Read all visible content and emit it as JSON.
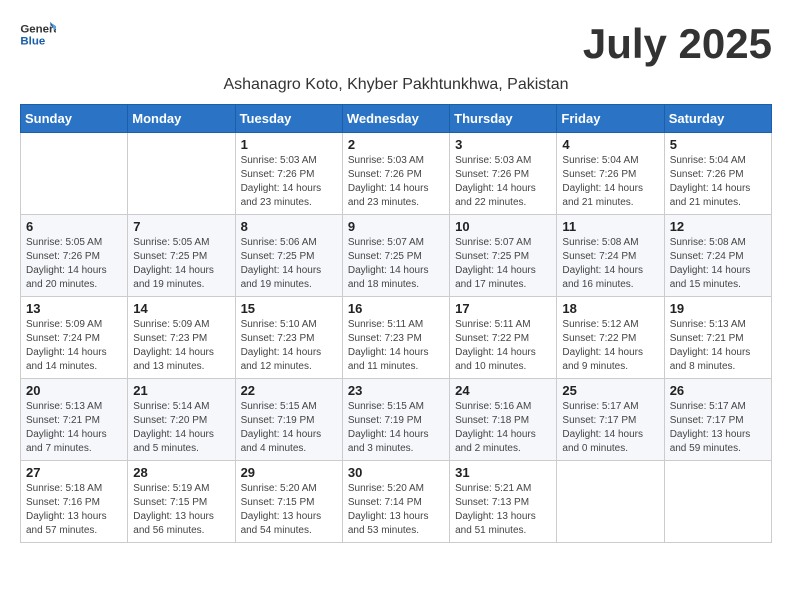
{
  "header": {
    "logo_line1": "General",
    "logo_line2": "Blue",
    "month": "July 2025",
    "location": "Ashanagro Koto, Khyber Pakhtunkhwa, Pakistan"
  },
  "weekdays": [
    "Sunday",
    "Monday",
    "Tuesday",
    "Wednesday",
    "Thursday",
    "Friday",
    "Saturday"
  ],
  "weeks": [
    [
      {
        "day": "",
        "sunrise": "",
        "sunset": "",
        "daylight": ""
      },
      {
        "day": "",
        "sunrise": "",
        "sunset": "",
        "daylight": ""
      },
      {
        "day": "1",
        "sunrise": "Sunrise: 5:03 AM",
        "sunset": "Sunset: 7:26 PM",
        "daylight": "Daylight: 14 hours and 23 minutes."
      },
      {
        "day": "2",
        "sunrise": "Sunrise: 5:03 AM",
        "sunset": "Sunset: 7:26 PM",
        "daylight": "Daylight: 14 hours and 23 minutes."
      },
      {
        "day": "3",
        "sunrise": "Sunrise: 5:03 AM",
        "sunset": "Sunset: 7:26 PM",
        "daylight": "Daylight: 14 hours and 22 minutes."
      },
      {
        "day": "4",
        "sunrise": "Sunrise: 5:04 AM",
        "sunset": "Sunset: 7:26 PM",
        "daylight": "Daylight: 14 hours and 21 minutes."
      },
      {
        "day": "5",
        "sunrise": "Sunrise: 5:04 AM",
        "sunset": "Sunset: 7:26 PM",
        "daylight": "Daylight: 14 hours and 21 minutes."
      }
    ],
    [
      {
        "day": "6",
        "sunrise": "Sunrise: 5:05 AM",
        "sunset": "Sunset: 7:26 PM",
        "daylight": "Daylight: 14 hours and 20 minutes."
      },
      {
        "day": "7",
        "sunrise": "Sunrise: 5:05 AM",
        "sunset": "Sunset: 7:25 PM",
        "daylight": "Daylight: 14 hours and 19 minutes."
      },
      {
        "day": "8",
        "sunrise": "Sunrise: 5:06 AM",
        "sunset": "Sunset: 7:25 PM",
        "daylight": "Daylight: 14 hours and 19 minutes."
      },
      {
        "day": "9",
        "sunrise": "Sunrise: 5:07 AM",
        "sunset": "Sunset: 7:25 PM",
        "daylight": "Daylight: 14 hours and 18 minutes."
      },
      {
        "day": "10",
        "sunrise": "Sunrise: 5:07 AM",
        "sunset": "Sunset: 7:25 PM",
        "daylight": "Daylight: 14 hours and 17 minutes."
      },
      {
        "day": "11",
        "sunrise": "Sunrise: 5:08 AM",
        "sunset": "Sunset: 7:24 PM",
        "daylight": "Daylight: 14 hours and 16 minutes."
      },
      {
        "day": "12",
        "sunrise": "Sunrise: 5:08 AM",
        "sunset": "Sunset: 7:24 PM",
        "daylight": "Daylight: 14 hours and 15 minutes."
      }
    ],
    [
      {
        "day": "13",
        "sunrise": "Sunrise: 5:09 AM",
        "sunset": "Sunset: 7:24 PM",
        "daylight": "Daylight: 14 hours and 14 minutes."
      },
      {
        "day": "14",
        "sunrise": "Sunrise: 5:09 AM",
        "sunset": "Sunset: 7:23 PM",
        "daylight": "Daylight: 14 hours and 13 minutes."
      },
      {
        "day": "15",
        "sunrise": "Sunrise: 5:10 AM",
        "sunset": "Sunset: 7:23 PM",
        "daylight": "Daylight: 14 hours and 12 minutes."
      },
      {
        "day": "16",
        "sunrise": "Sunrise: 5:11 AM",
        "sunset": "Sunset: 7:23 PM",
        "daylight": "Daylight: 14 hours and 11 minutes."
      },
      {
        "day": "17",
        "sunrise": "Sunrise: 5:11 AM",
        "sunset": "Sunset: 7:22 PM",
        "daylight": "Daylight: 14 hours and 10 minutes."
      },
      {
        "day": "18",
        "sunrise": "Sunrise: 5:12 AM",
        "sunset": "Sunset: 7:22 PM",
        "daylight": "Daylight: 14 hours and 9 minutes."
      },
      {
        "day": "19",
        "sunrise": "Sunrise: 5:13 AM",
        "sunset": "Sunset: 7:21 PM",
        "daylight": "Daylight: 14 hours and 8 minutes."
      }
    ],
    [
      {
        "day": "20",
        "sunrise": "Sunrise: 5:13 AM",
        "sunset": "Sunset: 7:21 PM",
        "daylight": "Daylight: 14 hours and 7 minutes."
      },
      {
        "day": "21",
        "sunrise": "Sunrise: 5:14 AM",
        "sunset": "Sunset: 7:20 PM",
        "daylight": "Daylight: 14 hours and 5 minutes."
      },
      {
        "day": "22",
        "sunrise": "Sunrise: 5:15 AM",
        "sunset": "Sunset: 7:19 PM",
        "daylight": "Daylight: 14 hours and 4 minutes."
      },
      {
        "day": "23",
        "sunrise": "Sunrise: 5:15 AM",
        "sunset": "Sunset: 7:19 PM",
        "daylight": "Daylight: 14 hours and 3 minutes."
      },
      {
        "day": "24",
        "sunrise": "Sunrise: 5:16 AM",
        "sunset": "Sunset: 7:18 PM",
        "daylight": "Daylight: 14 hours and 2 minutes."
      },
      {
        "day": "25",
        "sunrise": "Sunrise: 5:17 AM",
        "sunset": "Sunset: 7:17 PM",
        "daylight": "Daylight: 14 hours and 0 minutes."
      },
      {
        "day": "26",
        "sunrise": "Sunrise: 5:17 AM",
        "sunset": "Sunset: 7:17 PM",
        "daylight": "Daylight: 13 hours and 59 minutes."
      }
    ],
    [
      {
        "day": "27",
        "sunrise": "Sunrise: 5:18 AM",
        "sunset": "Sunset: 7:16 PM",
        "daylight": "Daylight: 13 hours and 57 minutes."
      },
      {
        "day": "28",
        "sunrise": "Sunrise: 5:19 AM",
        "sunset": "Sunset: 7:15 PM",
        "daylight": "Daylight: 13 hours and 56 minutes."
      },
      {
        "day": "29",
        "sunrise": "Sunrise: 5:20 AM",
        "sunset": "Sunset: 7:15 PM",
        "daylight": "Daylight: 13 hours and 54 minutes."
      },
      {
        "day": "30",
        "sunrise": "Sunrise: 5:20 AM",
        "sunset": "Sunset: 7:14 PM",
        "daylight": "Daylight: 13 hours and 53 minutes."
      },
      {
        "day": "31",
        "sunrise": "Sunrise: 5:21 AM",
        "sunset": "Sunset: 7:13 PM",
        "daylight": "Daylight: 13 hours and 51 minutes."
      },
      {
        "day": "",
        "sunrise": "",
        "sunset": "",
        "daylight": ""
      },
      {
        "day": "",
        "sunrise": "",
        "sunset": "",
        "daylight": ""
      }
    ]
  ]
}
